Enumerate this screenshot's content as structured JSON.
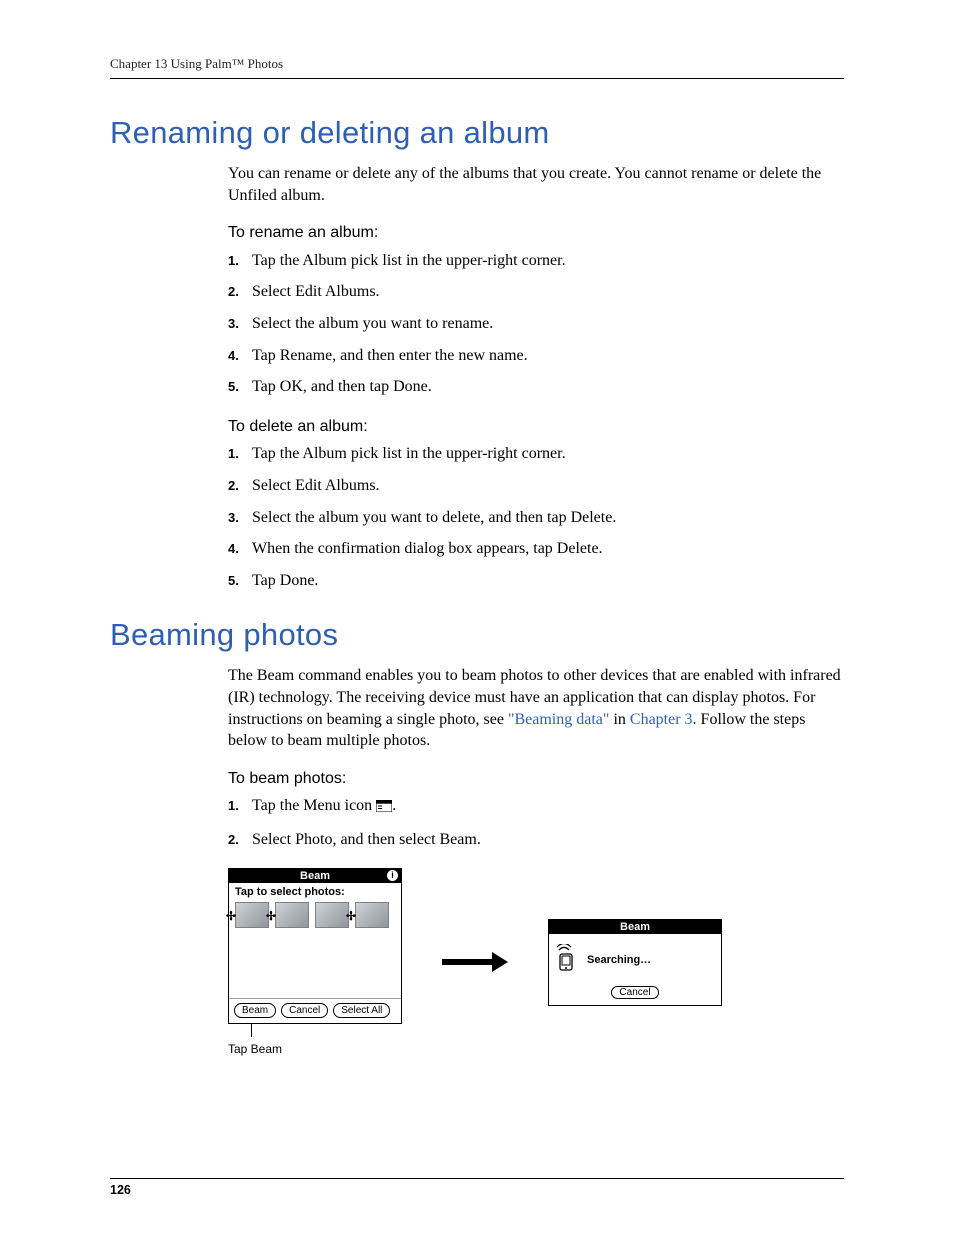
{
  "running_head": "Chapter 13   Using Palm™ Photos",
  "page_number": "126",
  "section1": {
    "title": "Renaming or deleting an album",
    "intro": "You can rename or delete any of the albums that you create. You cannot rename or delete the Unfiled album.",
    "proc_rename_title": "To rename an album:",
    "proc_rename_steps": [
      "Tap the Album pick list in the upper-right corner.",
      "Select Edit Albums.",
      "Select the album you want to rename.",
      "Tap Rename, and then enter the new name.",
      "Tap OK, and then tap Done."
    ],
    "proc_delete_title": "To delete an album:",
    "proc_delete_steps": [
      "Tap the Album pick list in the upper-right corner.",
      "Select Edit Albums.",
      "Select the album you want to delete, and then tap Delete.",
      "When the confirmation dialog box appears, tap Delete.",
      "Tap Done."
    ]
  },
  "section2": {
    "title": "Beaming photos",
    "intro_parts": {
      "p1": "The Beam command enables you to beam photos to other devices that are enabled with infrared (IR) technology. The receiving device must have an application that can display photos. For instructions on beaming a single photo, see ",
      "link1": "\"Beaming data\"",
      "p2": " in ",
      "link2": "Chapter 3",
      "p3": ". Follow the steps below to beam multiple photos."
    },
    "proc_beam_title": "To beam photos:",
    "proc_beam_steps": [
      {
        "pre": "Tap the Menu icon ",
        "post": "."
      },
      "Select Photo, and then select Beam."
    ]
  },
  "fig": {
    "dlg1_title": "Beam",
    "dlg1_info": "i",
    "dlg1_sub": "Tap to select photos:",
    "dlg1_btn_beam": "Beam",
    "dlg1_btn_cancel": "Cancel",
    "dlg1_btn_selectall": "Select All",
    "dlg1_caption": "Tap Beam",
    "dlg2_title": "Beam",
    "dlg2_status": "Searching…",
    "dlg2_btn_cancel": "Cancel"
  }
}
